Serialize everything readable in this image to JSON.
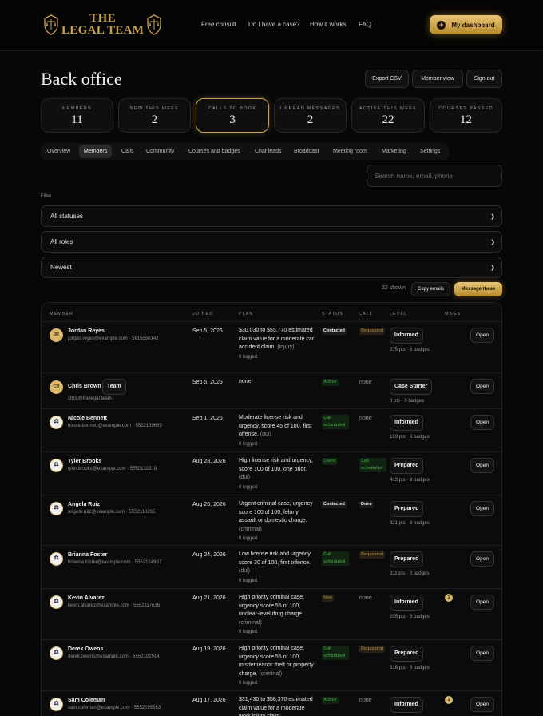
{
  "brand": {
    "logo_text": "THE\nLEGAL TEAM",
    "accent": "#c9a24a"
  },
  "nav": {
    "items": [
      "Free consult",
      "Do I have a case?",
      "How it works",
      "FAQ"
    ],
    "dashboard": "My dashboard"
  },
  "page": {
    "title": "Back office",
    "actions": [
      "Export CSV",
      "Member view",
      "Sign out"
    ]
  },
  "stats": [
    {
      "label": "MEMBERS",
      "value": "11"
    },
    {
      "label": "NEW THIS WEEK",
      "value": "2"
    },
    {
      "label": "CALLS TO BOOK",
      "value": "3"
    },
    {
      "label": "UNREAD MESSAGES",
      "value": "2"
    },
    {
      "label": "ACTIVE THIS WEEK",
      "value": "22"
    },
    {
      "label": "COURSES PASSED",
      "value": "12"
    }
  ],
  "tabs": [
    "Overview",
    "Members",
    "Calls",
    "Community",
    "Courses and badges",
    "Chat leads",
    "Broadcast",
    "Meeting room",
    "Marketing",
    "Settings"
  ],
  "active_tab": "Members",
  "search": {
    "placeholder": "Search name, email, phone"
  },
  "filter": {
    "label": "Filter",
    "status": "All statuses",
    "role": "All roles",
    "sort": "Newest"
  },
  "list": {
    "shown": "22 shown",
    "copy": "Copy emails",
    "message": "Message these"
  },
  "table": {
    "headers": [
      "MEMBER",
      "JOINED",
      "PLAN",
      "STATUS",
      "CALL",
      "LEVEL",
      "MSGS"
    ],
    "rows": [
      {
        "initials": "JR",
        "name": "Jordan Reyes",
        "contact": "jordan.reyes@example.com · 5615550142",
        "joined": "Sep 5, 2026",
        "plan": "$30,030 to $55,770 estimated claim value for a moderate car accident claim.",
        "tag": "(injury)",
        "logged": "0 logged",
        "status": "Contacted",
        "call": "Requested",
        "level": "Informed",
        "pts": "275 pts · 6 badges",
        "msgs": "",
        "open": "Open"
      },
      {
        "initials": "CB",
        "name": "Chris Brown",
        "team": "Team",
        "contact": "chris@thelegal.team ·",
        "joined": "Sep 5, 2026",
        "plan": "none",
        "tag": "",
        "logged": "",
        "status": "Active",
        "call": "none",
        "level": "Case Starter",
        "pts": "0 pts · 0 badges",
        "msgs": "",
        "open": "Open"
      },
      {
        "initials": "NB",
        "name": "Nicole Bennett",
        "contact": "nicole.bennett@example.com · 5552139669",
        "joined": "Sep 1, 2026",
        "plan": "Moderate license risk and urgency, score 45 of 100, first offense.",
        "tag": "(dui)",
        "logged": "0 logged",
        "status": "Call scheduled",
        "call": "none",
        "level": "Informed",
        "pts": "169 pts · 6 badges",
        "msgs": "",
        "open": "Open"
      },
      {
        "initials": "TB",
        "name": "Tyler Brooks",
        "contact": "tyler.brooks@example.com · 5552132318",
        "joined": "Aug 28, 2026",
        "plan": "High license risk and urgency, score 100 of 100, one prior.",
        "tag": "(dui)",
        "logged": "0 logged",
        "status": "Client",
        "call": "Call scheduled",
        "level": "Prepared",
        "pts": "413 pts · 9 badges",
        "msgs": "",
        "open": "Open"
      },
      {
        "initials": "AR",
        "name": "Angela Ruiz",
        "contact": "angela.ruiz@example.com · 5552110265",
        "joined": "Aug 26, 2026",
        "plan": "Urgent criminal case, urgency score 100 of 100, felony assault or domestic charge.",
        "tag": "(criminal)",
        "logged": "0 logged",
        "status": "Contacted",
        "call": "Done",
        "level": "Prepared",
        "pts": "321 pts · 8 badges",
        "msgs": "",
        "open": "Open"
      },
      {
        "initials": "BF",
        "name": "Brianna Foster",
        "contact": "brianna.foster@example.com · 5552124967",
        "joined": "Aug 24, 2026",
        "plan": "Low license risk and urgency, score 30 of 100, first offense.",
        "tag": "(dui)",
        "logged": "0 logged",
        "status": "Call scheduled",
        "call": "Requested",
        "level": "Prepared",
        "pts": "311 pts · 8 badges",
        "msgs": "",
        "open": "Open"
      },
      {
        "initials": "KA",
        "name": "Kevin Alvarez",
        "contact": "kevin.alvarez@example.com · 5552117616",
        "joined": "Aug 21, 2026",
        "plan": "High priority criminal case, urgency score 55 of 100, unclear-level drug charge.",
        "tag": "(criminal)",
        "logged": "0 logged",
        "status": "New",
        "call": "none",
        "level": "Informed",
        "pts": "205 pts · 6 badges",
        "msgs": "1",
        "open": "Open"
      },
      {
        "initials": "DO",
        "name": "Derek Owens",
        "contact": "derek.owens@example.com · 5552102914",
        "joined": "Aug 19, 2026",
        "plan": "High priority criminal case, urgency score 55 of 100, misdemeanor theft or property charge.",
        "tag": "(criminal)",
        "logged": "0 logged",
        "status": "Call scheduled",
        "call": "Requested",
        "level": "Prepared",
        "pts": "316 pts · 8 badges",
        "msgs": "",
        "open": "Open"
      },
      {
        "initials": "SC",
        "name": "Sam Coleman",
        "contact": "sam.coleman@example.com · 5552095563",
        "joined": "Aug 17, 2026",
        "plan": "$31,430 to $58,370 estimated claim value for a moderate work injury claim.",
        "tag": "",
        "logged": "",
        "status": "Active",
        "call": "none",
        "level": "Informed",
        "pts": "179 pts · 5 badges",
        "msgs": "1",
        "open": "Open"
      }
    ]
  }
}
